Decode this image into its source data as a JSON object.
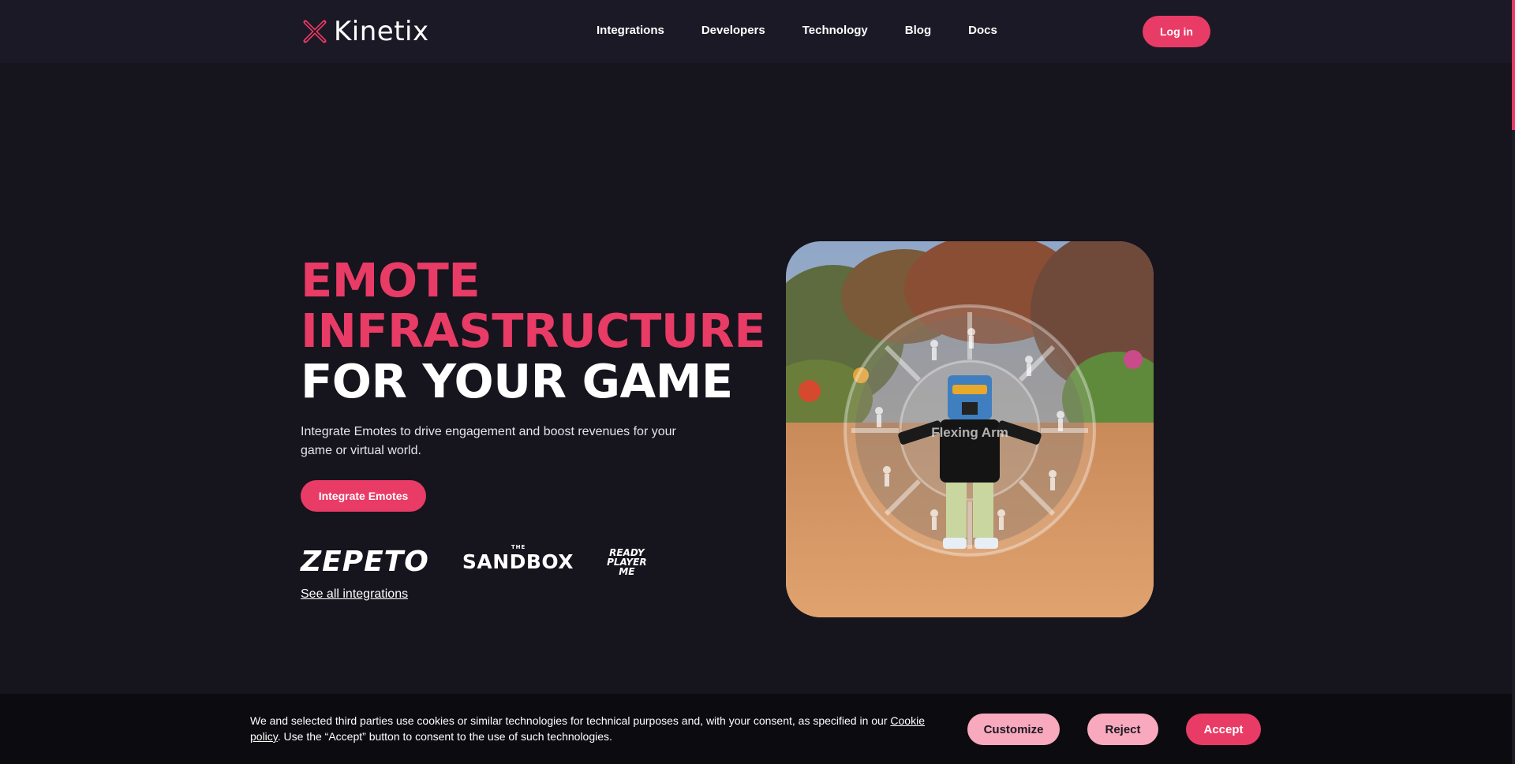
{
  "header": {
    "logo_text": "Kinetix",
    "nav": [
      "Integrations",
      "Developers",
      "Technology",
      "Blog",
      "Docs"
    ],
    "login_label": "Log in"
  },
  "hero": {
    "title_line1": "EMOTE",
    "title_line2": "INFRASTRUCTURE",
    "title_line3": "FOR YOUR GAME",
    "subtitle": "Integrate Emotes to drive engagement and boost revenues for your game or virtual world.",
    "cta_label": "Integrate Emotes",
    "partners": {
      "zepeto": "ZEPETO",
      "sandbox_small": "THE",
      "sandbox": "SANDBOX",
      "rpm_line1": "READY",
      "rpm_line2": "PLAYER",
      "rpm_line3": "ME"
    },
    "see_all_label": "See all integrations",
    "image_caption": "Flexing Arm"
  },
  "cookie": {
    "text_before": "We and selected third parties use cookies or similar technologies for technical purposes and, with your consent, as specified in our ",
    "link_label": "Cookie policy",
    "text_after": ". Use the “Accept” button to consent to the use of such technologies.",
    "customize_label": "Customize",
    "reject_label": "Reject",
    "accept_label": "Accept"
  },
  "colors": {
    "background": "#16141d",
    "accent": "#e83b66",
    "secondary_button": "#f9a9bd"
  }
}
